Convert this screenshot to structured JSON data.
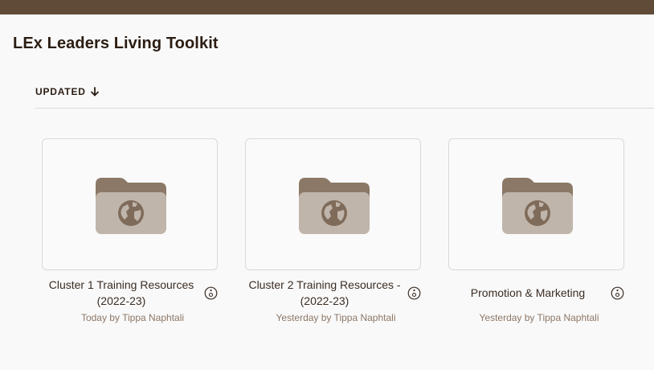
{
  "header": {
    "title": "LEx Leaders Living Toolkit"
  },
  "sort": {
    "label": "UPDATED",
    "direction_icon": "arrow-down-icon"
  },
  "folders": [
    {
      "name": "Cluster 1 Training Resources (2022-23)",
      "updated": "Today by Tippa Naphtali",
      "icon": "shared-folder-globe-icon",
      "info_icon": "info-icon"
    },
    {
      "name": "Cluster 2 Training Resources - (2022-23)",
      "updated": "Yesterday by Tippa Naphtali",
      "icon": "shared-folder-globe-icon",
      "info_icon": "info-icon"
    },
    {
      "name": "Promotion & Marketing",
      "updated": "Yesterday by Tippa Naphtali",
      "icon": "shared-folder-globe-icon",
      "info_icon": "info-icon"
    }
  ],
  "colors": {
    "topbar": "#604b39",
    "folder_tab": "#8b7866",
    "folder_body": "#c0b5aa",
    "byline": "#8c7767"
  }
}
